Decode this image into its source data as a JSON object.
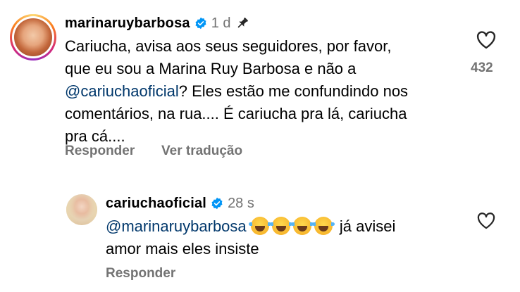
{
  "comment": {
    "username": "marinaruybarbosa",
    "time": "1 d",
    "text_line1": "Cariucha, avisa aos seus seguidores, por favor,",
    "text_line2": "que eu sou a Marina Ruy Barbosa e não a",
    "mention": "@cariuchaoficial",
    "text_line3_rest": "? Eles estão me confundindo nos",
    "text_line4": "comentários, na rua.... É cariucha pra lá, cariucha",
    "text_line5": "pra cá....",
    "like_count": "432",
    "reply_label": "Responder",
    "translate_label": "Ver tradução"
  },
  "reply": {
    "username": "cariuchaoficial",
    "time": "28 s",
    "mention": "@marinaruybarbosa",
    "emoji_count": 4,
    "text_rest": "já avisei",
    "text_line2": "amor mais eles insiste",
    "reply_label": "Responder"
  },
  "colors": {
    "verified": "#0095f6",
    "mention": "#00376b",
    "meta": "#737373",
    "story_ring_start": "#feda75",
    "story_ring_end": "#d62976"
  },
  "icons": [
    "verified-badge",
    "pin-icon",
    "heart-outline-icon",
    "laughing-emoji"
  ]
}
